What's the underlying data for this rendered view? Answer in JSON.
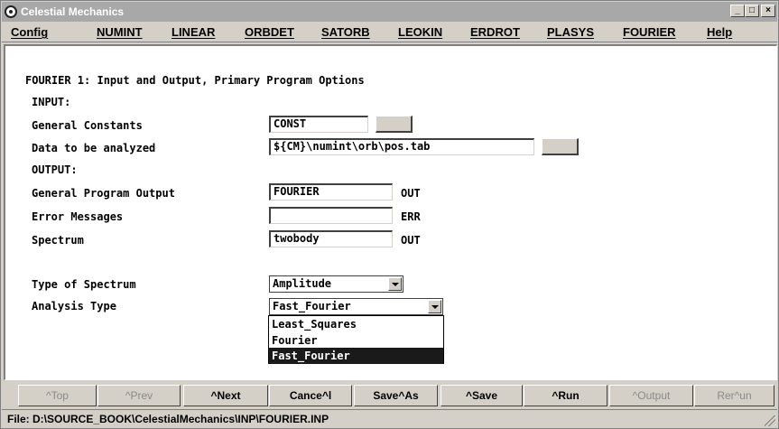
{
  "window": {
    "title": "Celestial Mechanics",
    "controls": [
      "_",
      "□",
      "×"
    ]
  },
  "menu": [
    "Config",
    "NUMINT",
    "LINEAR",
    "ORBDET",
    "SATORB",
    "LEOKIN",
    "ERDROT",
    "PLASYS",
    "FOURIER",
    "Help"
  ],
  "form": {
    "heading": "FOURIER 1: Input and Output, Primary Program Options",
    "input_section": "INPUT:",
    "general_constants": {
      "label": "General Constants",
      "value": "CONST"
    },
    "data_analyzed": {
      "label": "Data to be analyzed",
      "value": "${CM}\\numint\\orb\\pos.tab"
    },
    "output_section": "OUTPUT:",
    "program_output": {
      "label": "General Program Output",
      "value": "FOURIER",
      "ext": "OUT"
    },
    "error_messages": {
      "label": "Error Messages",
      "value": "",
      "ext": "ERR"
    },
    "spectrum": {
      "label": "Spectrum",
      "value": "twobody",
      "ext": "OUT"
    },
    "spectrum_type": {
      "label": "Type of Spectrum",
      "value": "Amplitude"
    },
    "analysis_type": {
      "label": "Analysis Type",
      "value": "Fast_Fourier",
      "options": [
        "Least_Squares",
        "Fourier",
        "Fast_Fourier"
      ]
    }
  },
  "toolbar": {
    "top": "^Top",
    "prev": "^Prev",
    "next": "^Next",
    "cancel": "Cance^l",
    "save_as": "Save^As",
    "save": "^Save",
    "run": "^Run",
    "output": "^Output",
    "rerun": "Rer^un"
  },
  "status": "File: D:\\SOURCE_BOOK\\CelestialMechanics\\INP\\FOURIER.INP"
}
